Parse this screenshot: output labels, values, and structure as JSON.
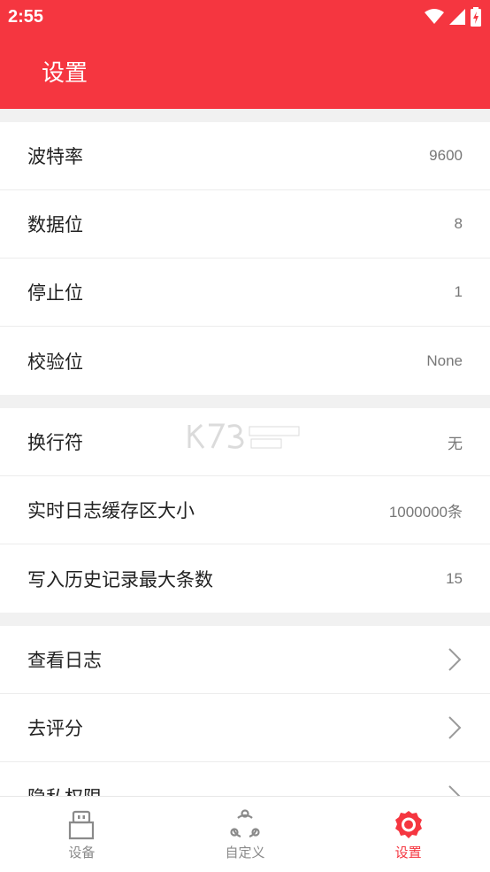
{
  "statusbar": {
    "time": "2:55"
  },
  "header": {
    "title": "设置"
  },
  "groups": [
    {
      "items": [
        {
          "label": "波特率",
          "value": "9600"
        },
        {
          "label": "数据位",
          "value": "8"
        },
        {
          "label": "停止位",
          "value": "1"
        },
        {
          "label": "校验位",
          "value": "None"
        }
      ]
    },
    {
      "items": [
        {
          "label": "换行符",
          "value": "无"
        },
        {
          "label": "实时日志缓存区大小",
          "value": "1000000条"
        },
        {
          "label": "写入历史记录最大条数",
          "value": "15"
        }
      ]
    },
    {
      "items": [
        {
          "label": "查看日志",
          "icon": "chevron-right-icon"
        },
        {
          "label": "去评分",
          "icon": "chevron-right-icon"
        },
        {
          "label": "隐私权限",
          "icon": "chevron-right-icon"
        }
      ]
    }
  ],
  "tabbar": {
    "tabs": [
      {
        "label": "设备",
        "icon": "usb-device-icon",
        "active": false
      },
      {
        "label": "自定义",
        "icon": "share-nodes-icon",
        "active": false
      },
      {
        "label": "设置",
        "icon": "settings-gear-icon",
        "active": true
      }
    ]
  },
  "colors": {
    "accent": "#f53640",
    "background": "#f1f1f1",
    "inactive": "#8a8a8a"
  }
}
